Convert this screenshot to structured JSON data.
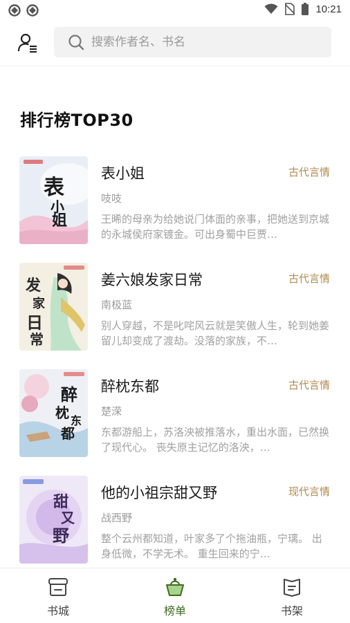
{
  "status_bar": {
    "time": "10:21",
    "left_icons": [
      "app-notification-icon",
      "app-notification-icon"
    ],
    "right_icons": [
      "wifi-icon",
      "no-sim-icon",
      "battery-icon"
    ]
  },
  "header": {
    "profile_icon": "user-menu-icon",
    "search": {
      "placeholder": "搜索作者名、书名",
      "value": ""
    }
  },
  "section": {
    "title": "排行榜TOP30"
  },
  "books": [
    {
      "title": "表小姐",
      "tag": "古代言情",
      "author": "吱吱",
      "description": "王晞的母亲为给她说门体面的亲事，把她送到京城的永城侯府家镀金。可出身蜀中巨贾…",
      "cover_colors": {
        "bg": "#e9eef6",
        "accent": "#f2c4d6",
        "ink": "#1b1b1b"
      }
    },
    {
      "title": "姜六娘发家日常",
      "tag": "古代言情",
      "author": "南极蓝",
      "description": "别人穿越，不是叱咤风云就是笑傲人生，轮到她姜留儿却变成了渡劫。没落的家族，不…",
      "cover_colors": {
        "bg": "#f3efe3",
        "accent": "#e0c46a",
        "ink": "#2a2a2a"
      }
    },
    {
      "title": "醉枕东都",
      "tag": "古代言情",
      "author": "楚溁",
      "description": "东都游船上，苏洛泱被推落水，重出水面，已然换了现代心。 丧失原主记忆的洛泱，…",
      "cover_colors": {
        "bg": "#eef0f5",
        "accent": "#e7a9bd",
        "ink": "#1b1b1b"
      }
    },
    {
      "title": "他的小祖宗甜又野",
      "tag": "现代言情",
      "author": "战西野",
      "description": "整个云州都知道，叶家多了个拖油瓶，宁璃。 出身低微，不学无术。 重生回来的宁…",
      "cover_colors": {
        "bg": "#efe8f6",
        "accent": "#c7a6e3",
        "ink": "#3c2a5a"
      }
    }
  ],
  "tabbar": {
    "tabs": [
      {
        "label": "书城",
        "icon": "bookstore-icon",
        "active": false
      },
      {
        "label": "榜单",
        "icon": "ranking-basket-icon",
        "active": true
      },
      {
        "label": "书架",
        "icon": "bookshelf-icon",
        "active": false
      }
    ],
    "active_color": "#3d6b1f"
  }
}
